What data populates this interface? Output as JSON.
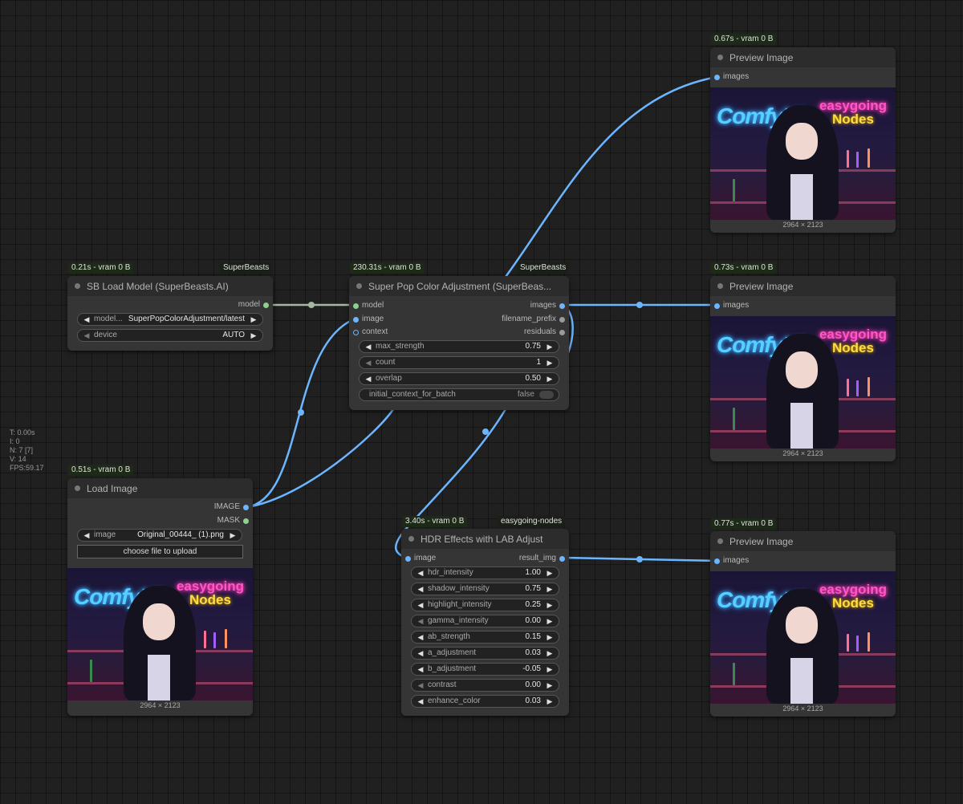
{
  "stats": {
    "lines": [
      "T: 0.00s",
      "I: 0",
      "N: 7 [7]",
      "V: 14",
      "FPS:59.17"
    ]
  },
  "nodes": {
    "preview1": {
      "time": "0.67s - vram 0 B",
      "title": "Preview Image",
      "input": "images",
      "dims": "2964 × 2123"
    },
    "preview2": {
      "time": "0.73s - vram 0 B",
      "title": "Preview Image",
      "input": "images",
      "dims": "2964 × 2123"
    },
    "preview3": {
      "time": "0.77s - vram 0 B",
      "title": "Preview Image",
      "input": "images",
      "dims": "2964 × 2123"
    },
    "load_model": {
      "time": "0.21s - vram 0 B",
      "source": "SuperBeasts",
      "title": "SB Load Model (SuperBeasts.AI)",
      "output": "model",
      "widgets": [
        {
          "label": "model...",
          "value": "SuperPopColorAdjustment/latest"
        },
        {
          "label": "device",
          "value": "AUTO"
        }
      ]
    },
    "super_pop": {
      "time": "230.31s - vram 0 B",
      "source": "SuperBeasts",
      "title": "Super Pop Color Adjustment (SuperBeas...",
      "inputs": [
        "model",
        "image",
        "context"
      ],
      "outputs": [
        "images",
        "filename_prefix",
        "residuals"
      ],
      "widgets": [
        {
          "label": "max_strength",
          "value": "0.75"
        },
        {
          "label": "count",
          "value": "1"
        },
        {
          "label": "overlap",
          "value": "0.50"
        }
      ],
      "toggle": {
        "label": "initial_context_for_batch",
        "value": "false"
      }
    },
    "load_image": {
      "time": "0.51s - vram 0 B",
      "title": "Load Image",
      "outputs": [
        "IMAGE",
        "MASK"
      ],
      "widget": {
        "label": "image",
        "value": "Original_00444_ (1).png"
      },
      "upload_label": "choose file to upload",
      "dims": "2964 × 2123"
    },
    "hdr": {
      "time": "3.40s - vram 0 B",
      "source": "easygoing-nodes",
      "title": "HDR Effects with LAB Adjust",
      "input": "image",
      "output": "result_img",
      "widgets": [
        {
          "label": "hdr_intensity",
          "value": "1.00"
        },
        {
          "label": "shadow_intensity",
          "value": "0.75"
        },
        {
          "label": "highlight_intensity",
          "value": "0.25"
        },
        {
          "label": "gamma_intensity",
          "value": "0.00"
        },
        {
          "label": "ab_strength",
          "value": "0.15"
        },
        {
          "label": "a_adjustment",
          "value": "0.03"
        },
        {
          "label": "b_adjustment",
          "value": "-0.05"
        },
        {
          "label": "contrast",
          "value": "0.00"
        },
        {
          "label": "enhance_color",
          "value": "0.03"
        }
      ]
    }
  },
  "thumbnail": {
    "sign_left": "ComfyUI",
    "sign_right_top": "easygoing",
    "sign_right_bottom": "Nodes"
  },
  "colors": {
    "canvas": "#202020",
    "node": "#353535",
    "link_image": "#6cb6ff",
    "link_model": "#a8b8a0",
    "badge_bg": "#1d2a18"
  },
  "icons": {
    "arrow_left": "◀",
    "arrow_right": "▶",
    "node_dot": "circle"
  }
}
